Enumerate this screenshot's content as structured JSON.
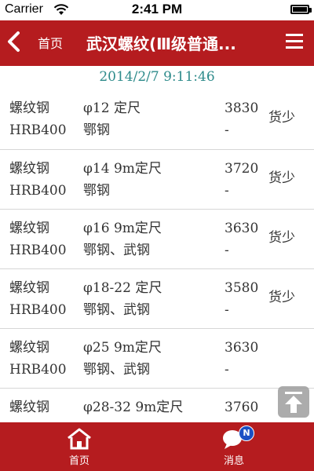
{
  "status_bar": {
    "carrier": "Carrier",
    "time": "2:41 PM"
  },
  "nav": {
    "home_link": "首页",
    "title": "武汉螺纹(Ⅲ级普通..."
  },
  "timestamp": "2014/2/7 9:11:46",
  "rows": [
    {
      "name": "螺纹钢",
      "grade": "HRB400",
      "spec": "φ12  定尺",
      "mill": "鄂钢",
      "price": "3830",
      "price_sub": "-",
      "status": "货少"
    },
    {
      "name": "螺纹钢",
      "grade": "HRB400",
      "spec": "φ14  9m定尺",
      "mill": "鄂钢",
      "price": "3720",
      "price_sub": "-",
      "status": "货少"
    },
    {
      "name": "螺纹钢",
      "grade": "HRB400",
      "spec": "φ16  9m定尺",
      "mill": "鄂钢、武钢",
      "price": "3630",
      "price_sub": "-",
      "status": "货少"
    },
    {
      "name": "螺纹钢",
      "grade": "HRB400",
      "spec": "φ18-22  定尺",
      "mill": "鄂钢、武钢",
      "price": "3580",
      "price_sub": "-",
      "status": "货少"
    },
    {
      "name": "螺纹钢",
      "grade": "HRB400",
      "spec": "φ25  9m定尺",
      "mill": "鄂钢、武钢",
      "price": "3630",
      "price_sub": "-",
      "status": ""
    },
    {
      "name": "螺纹钢",
      "grade": "",
      "spec": "φ28-32  9m定尺",
      "mill": "",
      "price": "3760",
      "price_sub": "",
      "status": ""
    }
  ],
  "tabs": {
    "home_label": "首页",
    "messages_label": "消息",
    "badge": "N"
  },
  "icons": {
    "back": "chevron-left-icon",
    "menu": "hamburger-icon",
    "wifi": "wifi-icon",
    "battery": "battery-icon",
    "home": "home-icon",
    "messages": "chat-bubble-icon",
    "scroll_top": "arrow-up-icon"
  },
  "colors": {
    "brand_red": "#b51c1f",
    "timestamp_teal": "#2e8b8b",
    "badge_blue": "#1b4fc4"
  }
}
